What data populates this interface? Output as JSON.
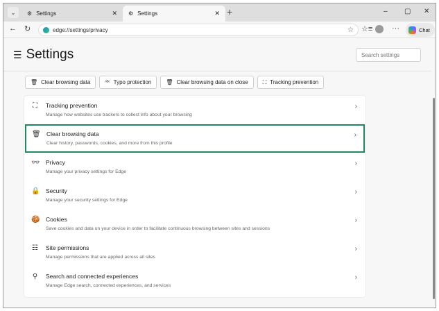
{
  "tabs": [
    {
      "label": "Settings",
      "active": false
    },
    {
      "label": "Settings",
      "active": true
    }
  ],
  "address": "edge://settings/privacy",
  "chat_label": "Chat",
  "page_title": "Settings",
  "search_placeholder": "Search settings",
  "quick_buttons": [
    {
      "label": "Clear browsing data",
      "icon": "trash-icon"
    },
    {
      "label": "Typo protection",
      "icon": "spellcheck-icon"
    },
    {
      "label": "Clear browsing data on close",
      "icon": "trash-clock-icon"
    },
    {
      "label": "Tracking prevention",
      "icon": "tracking-icon"
    }
  ],
  "items": [
    {
      "title": "Tracking prevention",
      "desc": "Manage how websites use trackers to collect info about your browsing"
    },
    {
      "title": "Clear browsing data",
      "desc": "Clear history, passwords, cookies, and more from this profile"
    },
    {
      "title": "Privacy",
      "desc": "Manage your privacy settings for Edge"
    },
    {
      "title": "Security",
      "desc": "Manage your security settings for Edge"
    },
    {
      "title": "Cookies",
      "desc": "Save cookies and data on your device in order to facilitate continuous browsing between sites and sessions"
    },
    {
      "title": "Site permissions",
      "desc": "Manage permissions that are applied across all sites"
    },
    {
      "title": "Search and connected experiences",
      "desc": "Manage Edge search, connected experiences, and services"
    }
  ],
  "highlight_color": "#1e8a5e"
}
